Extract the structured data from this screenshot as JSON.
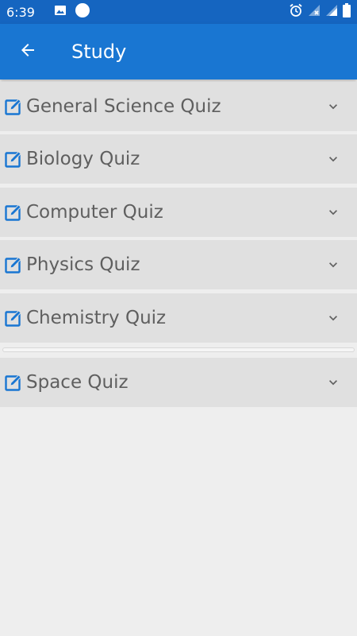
{
  "status_bar": {
    "time": "6:39",
    "icons": [
      "image-icon",
      "circle-icon",
      "alarm-icon",
      "signal-x-icon",
      "signal-icon",
      "battery-icon"
    ]
  },
  "app_bar": {
    "title": "Study",
    "back_icon": "arrow-back-icon"
  },
  "quizzes": [
    {
      "label": "General Science Quiz"
    },
    {
      "label": "Biology Quiz"
    },
    {
      "label": "Computer Quiz"
    },
    {
      "label": "Physics Quiz"
    },
    {
      "label": "Chemistry Quiz"
    },
    {
      "label": "Space Quiz"
    }
  ],
  "colors": {
    "app_bar": "#1976d2",
    "status_bar": "#1565c0",
    "icon_accent": "#1976d2",
    "item_background": "#e0e0e0",
    "label_text": "#5f5f5f"
  }
}
